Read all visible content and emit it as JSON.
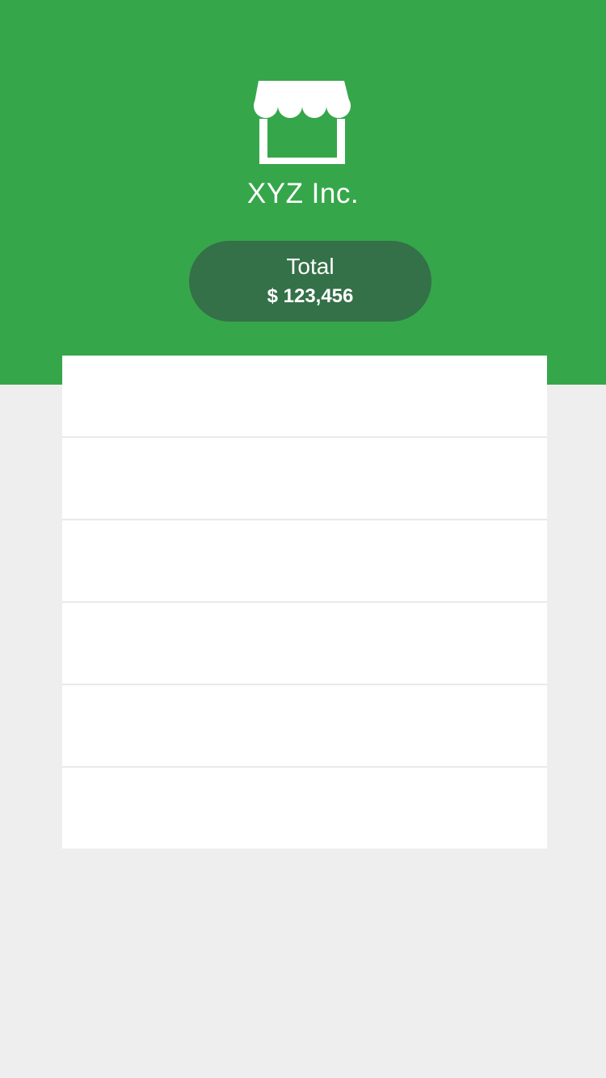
{
  "header": {
    "icon": "store-icon",
    "company_name": "XYZ Inc.",
    "total_label": "Total",
    "total_value": "$ 123,456"
  },
  "list": {
    "rows": [
      "",
      "",
      "",
      "",
      "",
      ""
    ]
  },
  "colors": {
    "header_background": "#36a64a",
    "total_pill_background": "#347048",
    "page_background": "#eeeeee",
    "card_background": "#ffffff",
    "divider": "#e8e9ec",
    "text": "#ffffff"
  }
}
